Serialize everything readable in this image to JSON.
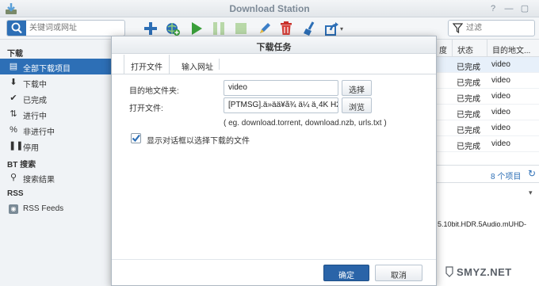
{
  "window": {
    "title": "Download Station"
  },
  "search": {
    "placeholder": "关键词或网址"
  },
  "filter": {
    "placeholder": "过滤"
  },
  "sidebar": {
    "sections": [
      {
        "heading": "下载"
      },
      {
        "heading": "BT 搜索"
      },
      {
        "heading": "RSS"
      }
    ],
    "items": [
      {
        "label": "全部下载项目",
        "icon": "list-icon"
      },
      {
        "label": "下载中",
        "icon": "download-icon"
      },
      {
        "label": "已完成",
        "icon": "check-icon"
      },
      {
        "label": "进行中",
        "icon": "updown-icon"
      },
      {
        "label": "非进行中",
        "icon": "percent-icon"
      },
      {
        "label": "停用",
        "icon": "pause-icon"
      },
      {
        "label": "搜索结果",
        "icon": "search-icon"
      },
      {
        "label": "RSS Feeds",
        "icon": "rss-icon"
      }
    ]
  },
  "table": {
    "columns": [
      "度",
      "状态",
      "目的地文..."
    ],
    "rows": [
      {
        "status": "已完成",
        "dest": "video"
      },
      {
        "status": "已完成",
        "dest": "video"
      },
      {
        "status": "已完成",
        "dest": "video"
      },
      {
        "status": "已完成",
        "dest": "video"
      },
      {
        "status": "已完成",
        "dest": "video"
      },
      {
        "status": "已完成",
        "dest": "video"
      }
    ],
    "count": "8 个项目"
  },
  "detail": {
    "text": "5.10bit.HDR.5Audio.mUHD-"
  },
  "modal": {
    "title": "下载任务",
    "tabs": [
      "打开文件",
      "输入网址"
    ],
    "dest_label": "目的地文件夹:",
    "dest_value": "video",
    "select_button": "选择",
    "file_label": "打开文件:",
    "file_value": "[PTMSG].ä»ää¥ã¾ ä¼ ä¸4K H26",
    "browse_button": "浏览",
    "hint": "( eg. download.torrent, download.nzb, urls.txt )",
    "checkbox_label": "显示对话框以选择下载的文件",
    "checkbox_checked": true,
    "ok_button": "确定",
    "cancel_button": "取消"
  },
  "watermark": {
    "text": "SMYZ.NET"
  },
  "colors": {
    "accent": "#2d6fb6",
    "primary_button": "#2a64a8"
  }
}
